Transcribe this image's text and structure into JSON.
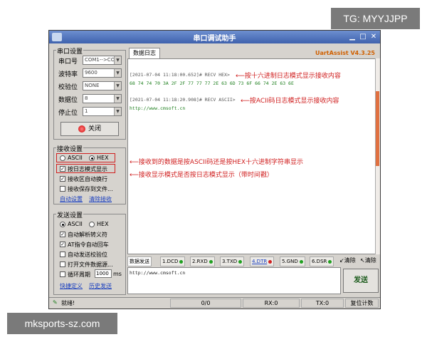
{
  "overlay": {
    "tg": "TG: MYYJJPP",
    "watermark": "mksports-sz.com"
  },
  "window": {
    "title": "串口调试助手",
    "controls": {
      "minimize": "▁",
      "maximize": "□",
      "close": "✕"
    }
  },
  "serial_settings": {
    "group": "串口设置",
    "rows": [
      {
        "label": "串口号",
        "value": "COM1-->COM"
      },
      {
        "label": "波特率",
        "value": "9600"
      },
      {
        "label": "校验位",
        "value": "NONE"
      },
      {
        "label": "数据位",
        "value": "8"
      },
      {
        "label": "停止位",
        "value": "1"
      }
    ],
    "close_button": "关闭"
  },
  "rx_settings": {
    "group": "接收设置",
    "ascii": "ASCII",
    "hex": "HEX",
    "log_mode": "按日志模式显示",
    "auto_wrap": "接收区自动换行",
    "save_file": "接收保存到文件...",
    "auto_save": "自动设置",
    "clear": "清除接收"
  },
  "tx_settings": {
    "group": "发送设置",
    "ascii": "ASCII",
    "hex": "HEX",
    "escape": "自动解析转义符",
    "at": "AT指令自动回车",
    "append_check": "自动发送校验位",
    "open_file": "打开文件数据源...",
    "cycle": "循环周期",
    "cycle_value": "1000",
    "cycle_unit": "ms",
    "shortcut": "快捷定义",
    "history": "历史发送"
  },
  "rx": {
    "tab": "数据日志",
    "brand": "UartAssist V4.3.25",
    "lines": [
      "[2021-07-04 11:18:00.652]# RECV HEX>",
      "68 74 74 70 3A 2F 2F 77 77 77 2E 63 6D 73 6F 66 74 2E 63 6E",
      "[2021-07-04 11:18:20.908]# RECV ASCII>",
      "http://www.cmsoft.cn"
    ],
    "annotations": {
      "hex_log": "按十六进制日志模式显示接收内容",
      "ascii_log": "按ACII码日志模式显示接收内容",
      "format": "接收到的数据是按ASCII码还是按HEX十六进制字符串显示",
      "log_mode": "接收显示模式是否按日志模式显示（带时间戳）"
    }
  },
  "tx": {
    "tab": "数据发送",
    "pins": [
      {
        "label": "1.DCD",
        "color": "#20a020"
      },
      {
        "label": "2.RXD",
        "color": "#20a020"
      },
      {
        "label": "3.TXD",
        "color": "#20a020"
      },
      {
        "label": "4.DTR",
        "color": "#d02020"
      },
      {
        "label": "5.GND",
        "color": "#20a020"
      },
      {
        "label": "6.DSR",
        "color": "#20a020"
      }
    ],
    "clear1": "清除",
    "clear2": "清除",
    "content": "http://www.cmsoft.cn",
    "send": "发送"
  },
  "status": {
    "ready": "就绪!",
    "counter": "0/0",
    "rx": "RX:0",
    "tx": "TX:0",
    "reset": "复位计数"
  }
}
